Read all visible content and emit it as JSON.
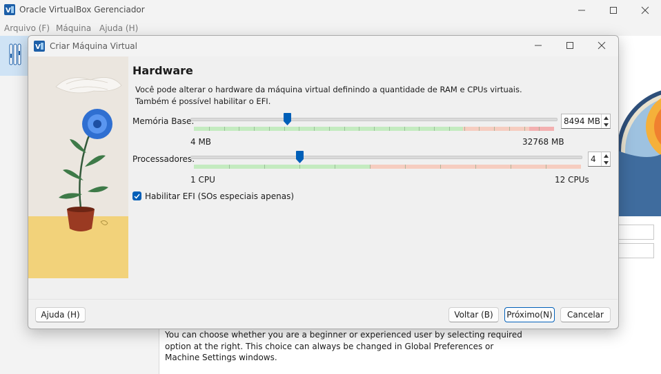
{
  "main": {
    "title": "Oracle VirtualBox Gerenciador",
    "menu": [
      "Arquivo (F)",
      "Máquina",
      "Ajuda (H)"
    ],
    "bottom_text": "You can choose whether you are a beginner or experienced user by selecting required option at the right. This choice can always be changed in Global Preferences or Machine Settings windows."
  },
  "dialog": {
    "title": "Criar Máquina Virtual",
    "heading": "Hardware",
    "description": "Você pode alterar o hardware da máquina virtual definindo a quantidade de RAM e CPUs virtuais. Também é possível habilitar o EFI.",
    "memory": {
      "label": "Memória Base:",
      "value_mb": 8494,
      "value_text": "8494 MB",
      "min_label": "4 MB",
      "max_label": "32768 MB",
      "min": 4,
      "max": 32768
    },
    "processors": {
      "label": "Processadores:",
      "value": 4,
      "value_text": "4",
      "min_label": "1 CPU",
      "max_label": "12 CPUs",
      "min": 1,
      "max": 12
    },
    "efi": {
      "label": "Habilitar EFI (SOs especiais apenas)",
      "checked": true
    },
    "buttons": {
      "help": "Ajuda (H)",
      "back": "Voltar (B)",
      "next": "Próximo(N)",
      "cancel": "Cancelar"
    }
  },
  "colors": {
    "accent": "#005fb8",
    "zone_green": "#c4ebc0",
    "zone_red": "#f6cdc0",
    "zone_red_strong": "#f3b0b0"
  }
}
